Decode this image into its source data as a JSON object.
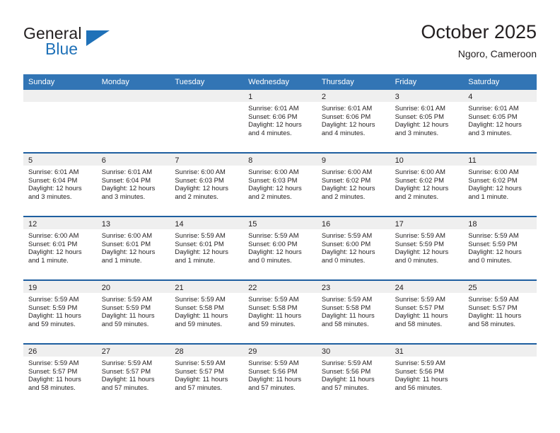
{
  "brand": {
    "name_part1": "General",
    "name_part2": "Blue",
    "accent_color": "#1f71b8"
  },
  "header": {
    "title": "October 2025",
    "location": "Ngoro, Cameroon"
  },
  "theme": {
    "header_row_bg": "#3275b5",
    "week_divider": "#1f5fa0",
    "date_band_bg": "#efefef",
    "text": "#231f20"
  },
  "weekdays": [
    "Sunday",
    "Monday",
    "Tuesday",
    "Wednesday",
    "Thursday",
    "Friday",
    "Saturday"
  ],
  "weeks": [
    [
      {
        "day": "",
        "sunrise": "",
        "sunset": "",
        "daylight": "",
        "empty": true
      },
      {
        "day": "",
        "sunrise": "",
        "sunset": "",
        "daylight": "",
        "empty": true
      },
      {
        "day": "",
        "sunrise": "",
        "sunset": "",
        "daylight": "",
        "empty": true
      },
      {
        "day": "1",
        "sunrise": "Sunrise: 6:01 AM",
        "sunset": "Sunset: 6:06 PM",
        "daylight": "Daylight: 12 hours and 4 minutes."
      },
      {
        "day": "2",
        "sunrise": "Sunrise: 6:01 AM",
        "sunset": "Sunset: 6:06 PM",
        "daylight": "Daylight: 12 hours and 4 minutes."
      },
      {
        "day": "3",
        "sunrise": "Sunrise: 6:01 AM",
        "sunset": "Sunset: 6:05 PM",
        "daylight": "Daylight: 12 hours and 3 minutes."
      },
      {
        "day": "4",
        "sunrise": "Sunrise: 6:01 AM",
        "sunset": "Sunset: 6:05 PM",
        "daylight": "Daylight: 12 hours and 3 minutes."
      }
    ],
    [
      {
        "day": "5",
        "sunrise": "Sunrise: 6:01 AM",
        "sunset": "Sunset: 6:04 PM",
        "daylight": "Daylight: 12 hours and 3 minutes."
      },
      {
        "day": "6",
        "sunrise": "Sunrise: 6:01 AM",
        "sunset": "Sunset: 6:04 PM",
        "daylight": "Daylight: 12 hours and 3 minutes."
      },
      {
        "day": "7",
        "sunrise": "Sunrise: 6:00 AM",
        "sunset": "Sunset: 6:03 PM",
        "daylight": "Daylight: 12 hours and 2 minutes."
      },
      {
        "day": "8",
        "sunrise": "Sunrise: 6:00 AM",
        "sunset": "Sunset: 6:03 PM",
        "daylight": "Daylight: 12 hours and 2 minutes."
      },
      {
        "day": "9",
        "sunrise": "Sunrise: 6:00 AM",
        "sunset": "Sunset: 6:02 PM",
        "daylight": "Daylight: 12 hours and 2 minutes."
      },
      {
        "day": "10",
        "sunrise": "Sunrise: 6:00 AM",
        "sunset": "Sunset: 6:02 PM",
        "daylight": "Daylight: 12 hours and 2 minutes."
      },
      {
        "day": "11",
        "sunrise": "Sunrise: 6:00 AM",
        "sunset": "Sunset: 6:02 PM",
        "daylight": "Daylight: 12 hours and 1 minute."
      }
    ],
    [
      {
        "day": "12",
        "sunrise": "Sunrise: 6:00 AM",
        "sunset": "Sunset: 6:01 PM",
        "daylight": "Daylight: 12 hours and 1 minute."
      },
      {
        "day": "13",
        "sunrise": "Sunrise: 6:00 AM",
        "sunset": "Sunset: 6:01 PM",
        "daylight": "Daylight: 12 hours and 1 minute."
      },
      {
        "day": "14",
        "sunrise": "Sunrise: 5:59 AM",
        "sunset": "Sunset: 6:01 PM",
        "daylight": "Daylight: 12 hours and 1 minute."
      },
      {
        "day": "15",
        "sunrise": "Sunrise: 5:59 AM",
        "sunset": "Sunset: 6:00 PM",
        "daylight": "Daylight: 12 hours and 0 minutes."
      },
      {
        "day": "16",
        "sunrise": "Sunrise: 5:59 AM",
        "sunset": "Sunset: 6:00 PM",
        "daylight": "Daylight: 12 hours and 0 minutes."
      },
      {
        "day": "17",
        "sunrise": "Sunrise: 5:59 AM",
        "sunset": "Sunset: 5:59 PM",
        "daylight": "Daylight: 12 hours and 0 minutes."
      },
      {
        "day": "18",
        "sunrise": "Sunrise: 5:59 AM",
        "sunset": "Sunset: 5:59 PM",
        "daylight": "Daylight: 12 hours and 0 minutes."
      }
    ],
    [
      {
        "day": "19",
        "sunrise": "Sunrise: 5:59 AM",
        "sunset": "Sunset: 5:59 PM",
        "daylight": "Daylight: 11 hours and 59 minutes."
      },
      {
        "day": "20",
        "sunrise": "Sunrise: 5:59 AM",
        "sunset": "Sunset: 5:59 PM",
        "daylight": "Daylight: 11 hours and 59 minutes."
      },
      {
        "day": "21",
        "sunrise": "Sunrise: 5:59 AM",
        "sunset": "Sunset: 5:58 PM",
        "daylight": "Daylight: 11 hours and 59 minutes."
      },
      {
        "day": "22",
        "sunrise": "Sunrise: 5:59 AM",
        "sunset": "Sunset: 5:58 PM",
        "daylight": "Daylight: 11 hours and 59 minutes."
      },
      {
        "day": "23",
        "sunrise": "Sunrise: 5:59 AM",
        "sunset": "Sunset: 5:58 PM",
        "daylight": "Daylight: 11 hours and 58 minutes."
      },
      {
        "day": "24",
        "sunrise": "Sunrise: 5:59 AM",
        "sunset": "Sunset: 5:57 PM",
        "daylight": "Daylight: 11 hours and 58 minutes."
      },
      {
        "day": "25",
        "sunrise": "Sunrise: 5:59 AM",
        "sunset": "Sunset: 5:57 PM",
        "daylight": "Daylight: 11 hours and 58 minutes."
      }
    ],
    [
      {
        "day": "26",
        "sunrise": "Sunrise: 5:59 AM",
        "sunset": "Sunset: 5:57 PM",
        "daylight": "Daylight: 11 hours and 58 minutes."
      },
      {
        "day": "27",
        "sunrise": "Sunrise: 5:59 AM",
        "sunset": "Sunset: 5:57 PM",
        "daylight": "Daylight: 11 hours and 57 minutes."
      },
      {
        "day": "28",
        "sunrise": "Sunrise: 5:59 AM",
        "sunset": "Sunset: 5:57 PM",
        "daylight": "Daylight: 11 hours and 57 minutes."
      },
      {
        "day": "29",
        "sunrise": "Sunrise: 5:59 AM",
        "sunset": "Sunset: 5:56 PM",
        "daylight": "Daylight: 11 hours and 57 minutes."
      },
      {
        "day": "30",
        "sunrise": "Sunrise: 5:59 AM",
        "sunset": "Sunset: 5:56 PM",
        "daylight": "Daylight: 11 hours and 57 minutes."
      },
      {
        "day": "31",
        "sunrise": "Sunrise: 5:59 AM",
        "sunset": "Sunset: 5:56 PM",
        "daylight": "Daylight: 11 hours and 56 minutes."
      },
      {
        "day": "",
        "sunrise": "",
        "sunset": "",
        "daylight": "",
        "empty": true
      }
    ]
  ]
}
